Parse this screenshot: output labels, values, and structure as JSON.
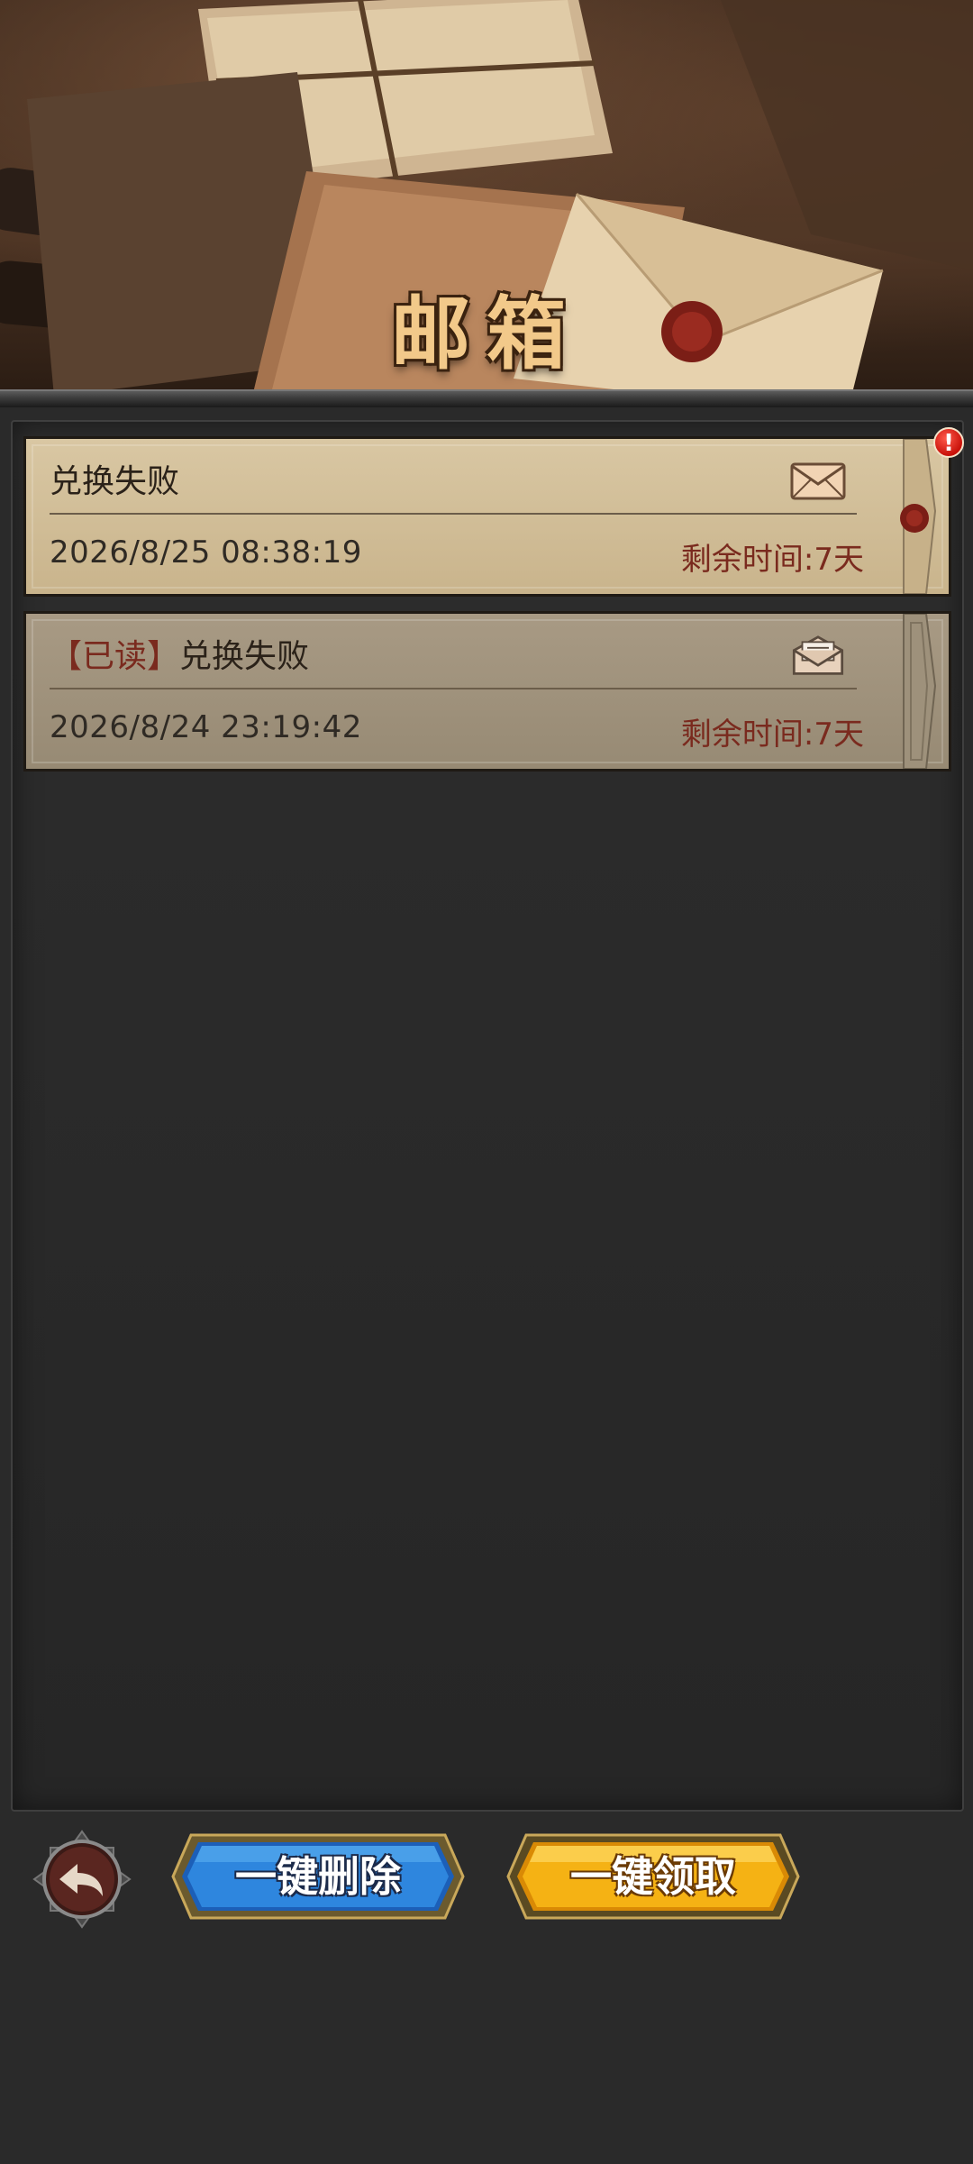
{
  "header": {
    "title": "邮箱"
  },
  "mails": [
    {
      "status": "unread",
      "tag": "",
      "subject": "兑换失败",
      "date": "2026/8/25  08:38:19",
      "remaining": "剩余时间:7天",
      "icon": "envelope-closed-icon",
      "has_alert": true,
      "alert_symbol": "!"
    },
    {
      "status": "read",
      "tag": "【已读】",
      "subject": "兑换失败",
      "date": "2026/8/24  23:19:42",
      "remaining": "剩余时间:7天",
      "icon": "envelope-open-icon",
      "has_alert": false
    }
  ],
  "footer": {
    "back_icon": "back-arrow-icon",
    "delete_all_label": "一键删除",
    "collect_all_label": "一键领取"
  },
  "colors": {
    "title": "#f2c98a",
    "unread_card": "#d9c7a3",
    "read_card": "#a89a84",
    "accent_red": "#7a2a1e",
    "delete_button": "#2e78d6",
    "collect_button": "#f2a90c"
  }
}
